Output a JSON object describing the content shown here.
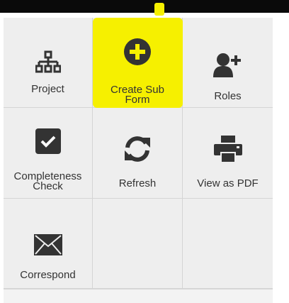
{
  "toolbar": {
    "items": [
      {
        "label": "Project",
        "icon": "org-chart-icon"
      },
      {
        "label": "Create Sub\nForm",
        "icon": "plus-circle-icon",
        "highlighted": true
      },
      {
        "label": "Roles",
        "icon": "add-user-icon"
      },
      {
        "label": "Completeness\nCheck",
        "icon": "checkbox-checked-icon"
      },
      {
        "label": "Refresh",
        "icon": "refresh-icon"
      },
      {
        "label": "View as PDF",
        "icon": "printer-icon"
      },
      {
        "label": "Correspond",
        "icon": "envelope-icon"
      }
    ]
  },
  "colors": {
    "highlight": "#f6f000",
    "icon": "#333333",
    "tile_bg": "#eeeeee",
    "top_bar": "#0a0a0a"
  }
}
